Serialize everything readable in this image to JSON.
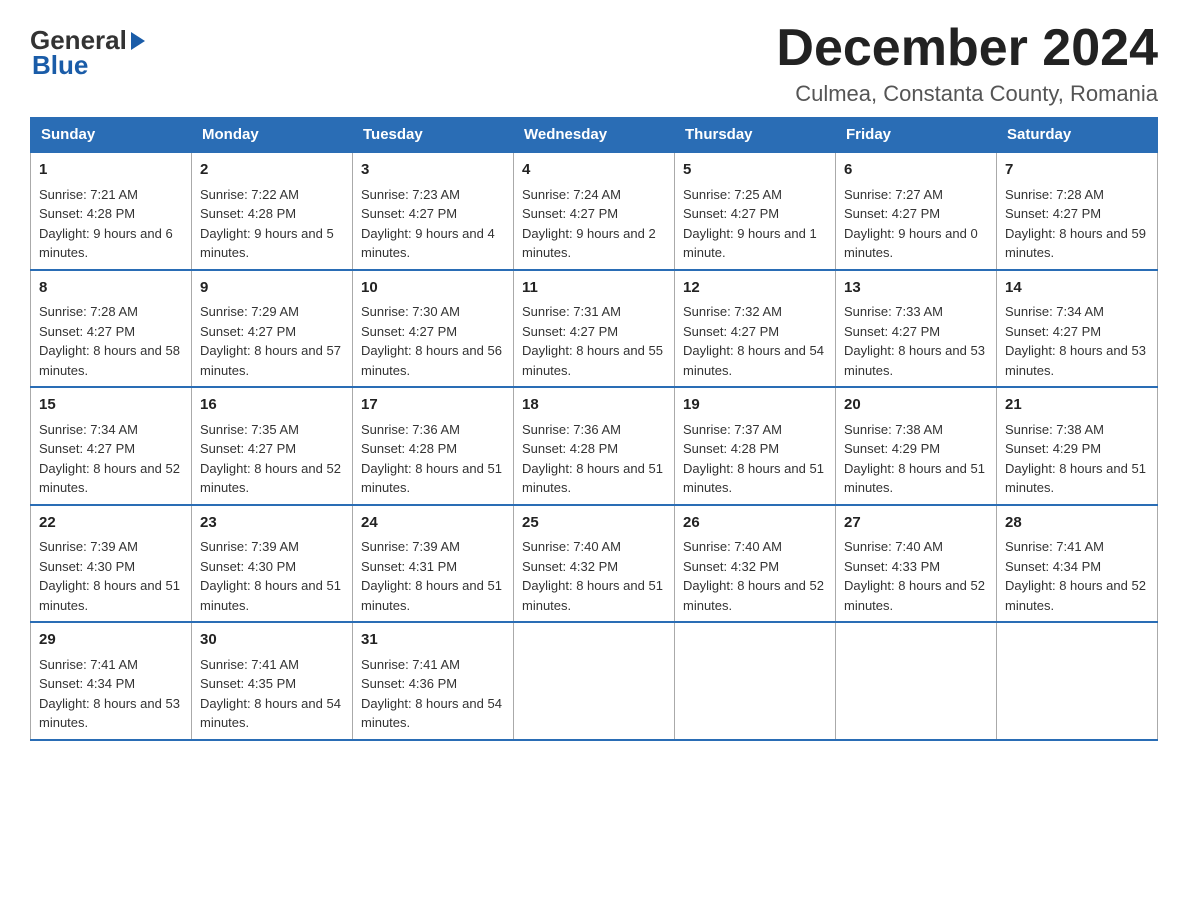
{
  "header": {
    "logo_general": "General",
    "logo_blue": "Blue",
    "month_title": "December 2024",
    "location": "Culmea, Constanta County, Romania"
  },
  "days_of_week": [
    "Sunday",
    "Monday",
    "Tuesday",
    "Wednesday",
    "Thursday",
    "Friday",
    "Saturday"
  ],
  "weeks": [
    [
      {
        "day": "1",
        "sunrise": "7:21 AM",
        "sunset": "4:28 PM",
        "daylight": "9 hours and 6 minutes."
      },
      {
        "day": "2",
        "sunrise": "7:22 AM",
        "sunset": "4:28 PM",
        "daylight": "9 hours and 5 minutes."
      },
      {
        "day": "3",
        "sunrise": "7:23 AM",
        "sunset": "4:27 PM",
        "daylight": "9 hours and 4 minutes."
      },
      {
        "day": "4",
        "sunrise": "7:24 AM",
        "sunset": "4:27 PM",
        "daylight": "9 hours and 2 minutes."
      },
      {
        "day": "5",
        "sunrise": "7:25 AM",
        "sunset": "4:27 PM",
        "daylight": "9 hours and 1 minute."
      },
      {
        "day": "6",
        "sunrise": "7:27 AM",
        "sunset": "4:27 PM",
        "daylight": "9 hours and 0 minutes."
      },
      {
        "day": "7",
        "sunrise": "7:28 AM",
        "sunset": "4:27 PM",
        "daylight": "8 hours and 59 minutes."
      }
    ],
    [
      {
        "day": "8",
        "sunrise": "7:28 AM",
        "sunset": "4:27 PM",
        "daylight": "8 hours and 58 minutes."
      },
      {
        "day": "9",
        "sunrise": "7:29 AM",
        "sunset": "4:27 PM",
        "daylight": "8 hours and 57 minutes."
      },
      {
        "day": "10",
        "sunrise": "7:30 AM",
        "sunset": "4:27 PM",
        "daylight": "8 hours and 56 minutes."
      },
      {
        "day": "11",
        "sunrise": "7:31 AM",
        "sunset": "4:27 PM",
        "daylight": "8 hours and 55 minutes."
      },
      {
        "day": "12",
        "sunrise": "7:32 AM",
        "sunset": "4:27 PM",
        "daylight": "8 hours and 54 minutes."
      },
      {
        "day": "13",
        "sunrise": "7:33 AM",
        "sunset": "4:27 PM",
        "daylight": "8 hours and 53 minutes."
      },
      {
        "day": "14",
        "sunrise": "7:34 AM",
        "sunset": "4:27 PM",
        "daylight": "8 hours and 53 minutes."
      }
    ],
    [
      {
        "day": "15",
        "sunrise": "7:34 AM",
        "sunset": "4:27 PM",
        "daylight": "8 hours and 52 minutes."
      },
      {
        "day": "16",
        "sunrise": "7:35 AM",
        "sunset": "4:27 PM",
        "daylight": "8 hours and 52 minutes."
      },
      {
        "day": "17",
        "sunrise": "7:36 AM",
        "sunset": "4:28 PM",
        "daylight": "8 hours and 51 minutes."
      },
      {
        "day": "18",
        "sunrise": "7:36 AM",
        "sunset": "4:28 PM",
        "daylight": "8 hours and 51 minutes."
      },
      {
        "day": "19",
        "sunrise": "7:37 AM",
        "sunset": "4:28 PM",
        "daylight": "8 hours and 51 minutes."
      },
      {
        "day": "20",
        "sunrise": "7:38 AM",
        "sunset": "4:29 PM",
        "daylight": "8 hours and 51 minutes."
      },
      {
        "day": "21",
        "sunrise": "7:38 AM",
        "sunset": "4:29 PM",
        "daylight": "8 hours and 51 minutes."
      }
    ],
    [
      {
        "day": "22",
        "sunrise": "7:39 AM",
        "sunset": "4:30 PM",
        "daylight": "8 hours and 51 minutes."
      },
      {
        "day": "23",
        "sunrise": "7:39 AM",
        "sunset": "4:30 PM",
        "daylight": "8 hours and 51 minutes."
      },
      {
        "day": "24",
        "sunrise": "7:39 AM",
        "sunset": "4:31 PM",
        "daylight": "8 hours and 51 minutes."
      },
      {
        "day": "25",
        "sunrise": "7:40 AM",
        "sunset": "4:32 PM",
        "daylight": "8 hours and 51 minutes."
      },
      {
        "day": "26",
        "sunrise": "7:40 AM",
        "sunset": "4:32 PM",
        "daylight": "8 hours and 52 minutes."
      },
      {
        "day": "27",
        "sunrise": "7:40 AM",
        "sunset": "4:33 PM",
        "daylight": "8 hours and 52 minutes."
      },
      {
        "day": "28",
        "sunrise": "7:41 AM",
        "sunset": "4:34 PM",
        "daylight": "8 hours and 52 minutes."
      }
    ],
    [
      {
        "day": "29",
        "sunrise": "7:41 AM",
        "sunset": "4:34 PM",
        "daylight": "8 hours and 53 minutes."
      },
      {
        "day": "30",
        "sunrise": "7:41 AM",
        "sunset": "4:35 PM",
        "daylight": "8 hours and 54 minutes."
      },
      {
        "day": "31",
        "sunrise": "7:41 AM",
        "sunset": "4:36 PM",
        "daylight": "8 hours and 54 minutes."
      },
      null,
      null,
      null,
      null
    ]
  ],
  "labels": {
    "sunrise": "Sunrise:",
    "sunset": "Sunset:",
    "daylight": "Daylight:"
  }
}
